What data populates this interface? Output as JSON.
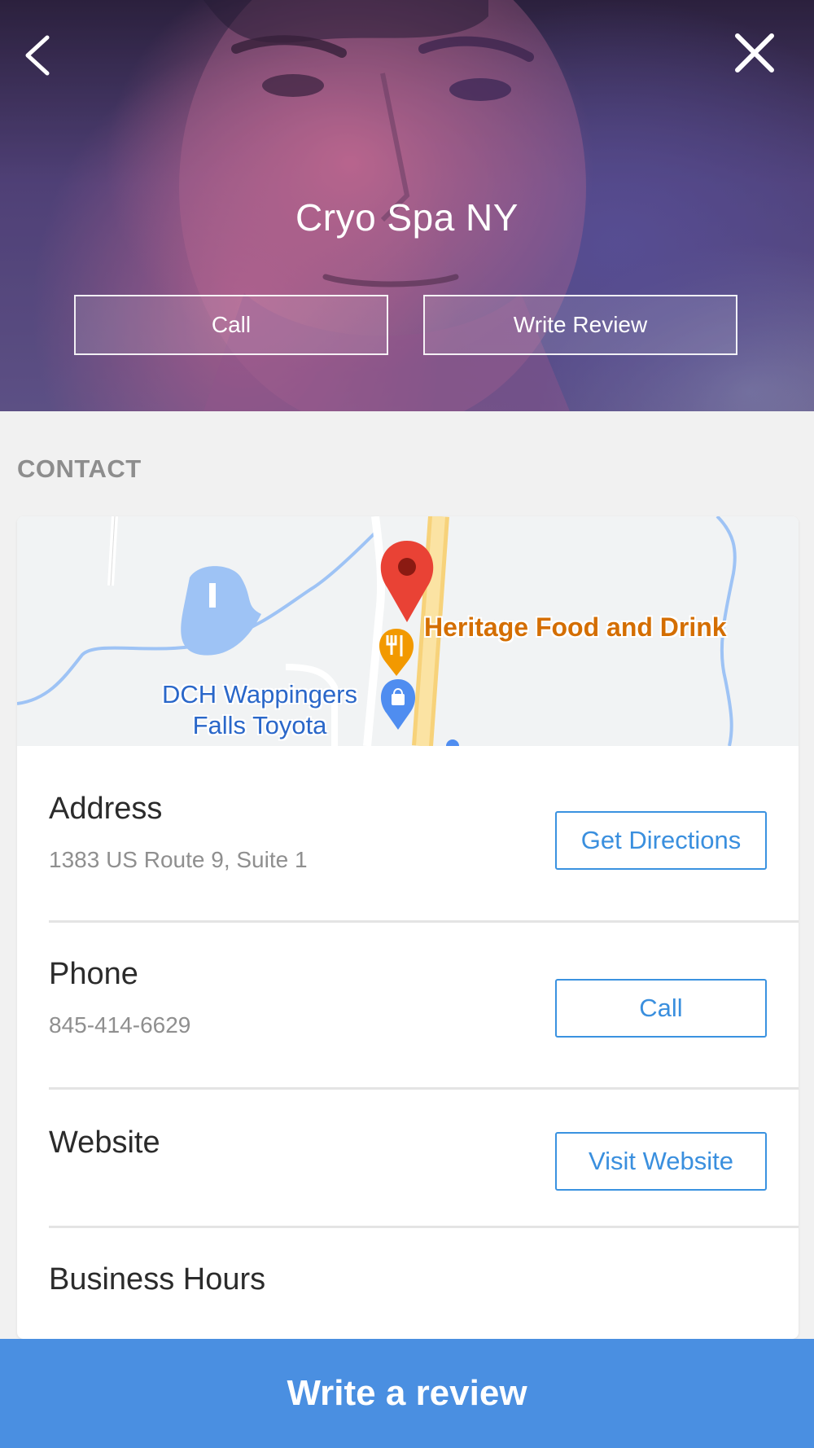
{
  "hero": {
    "title": "Cryo Spa NY",
    "call_label": "Call",
    "write_review_label": "Write Review"
  },
  "contact": {
    "section_label": "CONTACT",
    "map": {
      "poi_label": "Heritage Food and Drink",
      "dealer_line1": "DCH Wappingers",
      "dealer_line2": "Falls Toyota"
    },
    "address": {
      "title": "Address",
      "value": "1383 US Route 9, Suite 1",
      "button": "Get Directions"
    },
    "phone": {
      "title": "Phone",
      "value": "845-414-6629",
      "button": "Call"
    },
    "website": {
      "title": "Website",
      "button": "Visit Website"
    },
    "hours": {
      "title": "Business Hours"
    }
  },
  "cta": {
    "label": "Write a review"
  },
  "colors": {
    "accent": "#3a8fde",
    "cta_background": "#4a8fe1",
    "map_pin": "#e94235",
    "map_poi": "#d46e00"
  },
  "icons": [
    "back-chevron-icon",
    "close-icon",
    "map-pin-icon",
    "restaurant-marker-icon",
    "shopping-marker-icon"
  ]
}
